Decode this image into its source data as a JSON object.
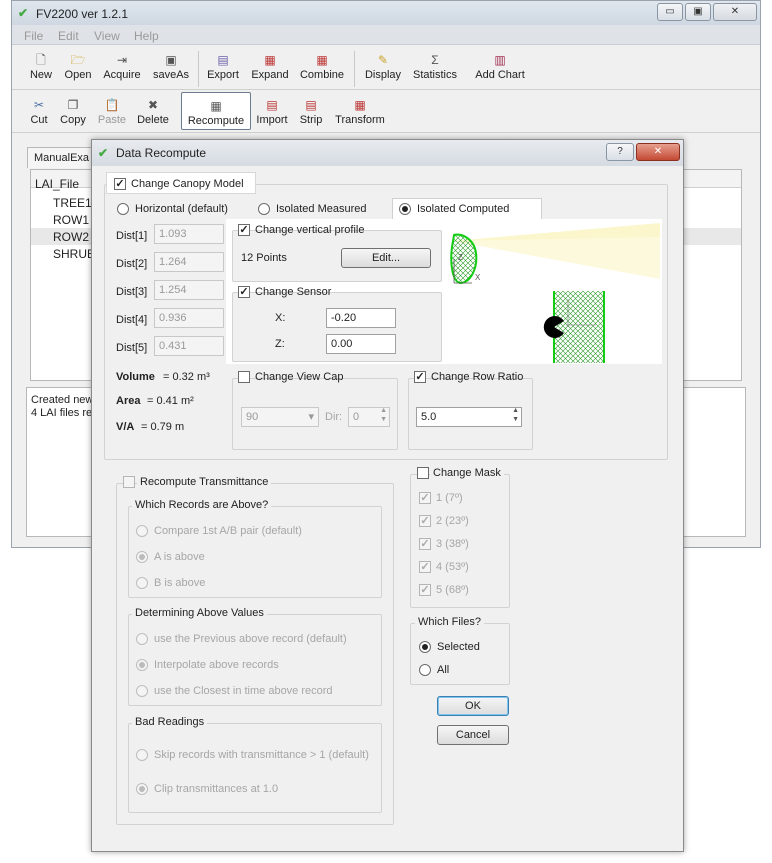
{
  "main_window": {
    "title": "FV2200 ver 1.2.1",
    "menu": [
      "File",
      "Edit",
      "View",
      "Help"
    ],
    "toolbar1": [
      "New",
      "Open",
      "Acquire",
      "saveAs",
      "Export",
      "Expand",
      "Combine",
      "Display",
      "Statistics",
      "Add Chart"
    ],
    "toolbar2": [
      "Cut",
      "Copy",
      "Paste",
      "Delete",
      "Recompute",
      "Import",
      "Strip",
      "Transform"
    ],
    "tab_label": "ManualExa",
    "list_header": "LAI_File",
    "list_items": [
      "TREE1",
      "ROW1",
      "ROW2",
      "SHRUB"
    ],
    "log_lines": [
      "Created new",
      "4 LAI files re"
    ]
  },
  "dialog": {
    "title": "Data Recompute",
    "help": "?",
    "close": "✕",
    "change_canopy_model": "Change Canopy Model",
    "radios": {
      "horizontal": "Horizontal (default)",
      "isolated_measured": "Isolated Measured",
      "isolated_computed": "Isolated Computed"
    },
    "dist": [
      {
        "label": "Dist[1]",
        "value": "1.093"
      },
      {
        "label": "Dist[2]",
        "value": "1.264"
      },
      {
        "label": "Dist[3]",
        "value": "1.254"
      },
      {
        "label": "Dist[4]",
        "value": "0.936"
      },
      {
        "label": "Dist[5]",
        "value": "0.431"
      }
    ],
    "volume_label": "Volume",
    "volume_value": "= 0.32 m³",
    "area_label": "Area",
    "area_value": "= 0.41 m²",
    "va_label": "V/A",
    "va_value": "= 0.79 m",
    "change_vertical_profile": "Change vertical profile",
    "points": "12 Points",
    "edit_button": "Edit...",
    "change_sensor": "Change Sensor",
    "sensor_x_label": "X:",
    "sensor_x": "-0.20",
    "sensor_z_label": "Z:",
    "sensor_z": "0.00",
    "profile_axis_z": "Z",
    "profile_axis_x": "X",
    "change_view_cap": "Change View Cap",
    "view_cap_value": "90",
    "dir_label": "Dir:",
    "dir_value": "0",
    "change_row_ratio": "Change Row Ratio",
    "row_ratio_value": "5.0",
    "recompute_transmittance": "Recompute Transmittance",
    "which_records_above": "Which Records are Above?",
    "compare_pair": "Compare 1st A/B pair (default)",
    "a_is_above": "A is above",
    "b_is_above": "B is above",
    "determining_above": "Determining Above Values",
    "use_previous": "use the Previous above record (default)",
    "interpolate": "Interpolate above records",
    "use_closest": "use the Closest in time above record",
    "bad_readings": "Bad Readings",
    "skip_records": "Skip records with transmittance > 1 (default)",
    "clip_trans": "Clip transmittances at 1.0",
    "change_mask": "Change Mask",
    "mask_items": [
      "1 (7º)",
      "2 (23º)",
      "3 (38º)",
      "4 (53º)",
      "5 (68º)"
    ],
    "which_files": "Which Files?",
    "selected": "Selected",
    "all": "All",
    "ok": "OK",
    "cancel": "Cancel"
  }
}
